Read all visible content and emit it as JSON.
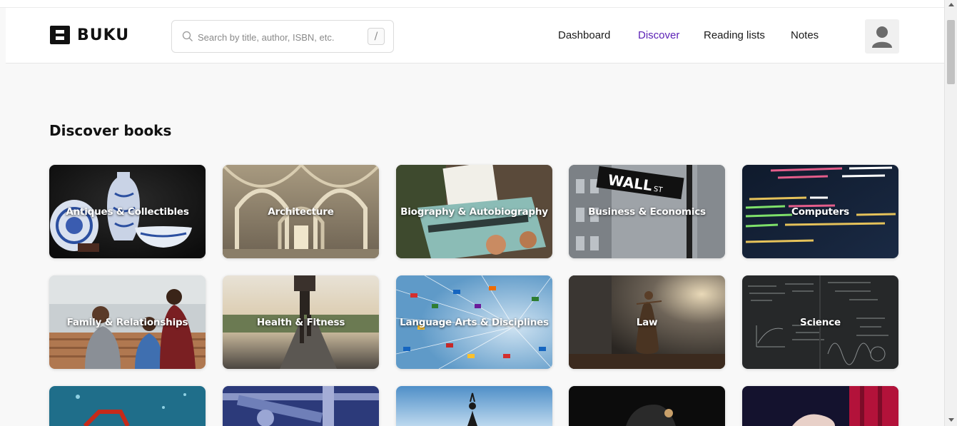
{
  "app": {
    "name": "BUKU"
  },
  "search": {
    "placeholder": "Search by title, author, ISBN, etc.",
    "shortcut": "/"
  },
  "nav": {
    "items": [
      {
        "label": "Dashboard",
        "active": false
      },
      {
        "label": "Discover",
        "active": true
      },
      {
        "label": "Reading lists",
        "active": false
      },
      {
        "label": "Notes",
        "active": false
      }
    ],
    "active_color": "#5b21b6"
  },
  "main": {
    "title": "Discover books",
    "categories": [
      {
        "label": "Antiques & Collectibles",
        "icon": "porcelain-vase"
      },
      {
        "label": "Architecture",
        "icon": "vaulted-hall"
      },
      {
        "label": "Biography & Autobiography",
        "icon": "typewriter"
      },
      {
        "label": "Business & Economics",
        "icon": "wall-street-sign"
      },
      {
        "label": "Computers",
        "icon": "code-screen"
      },
      {
        "label": "Family & Relationships",
        "icon": "family-kitchen"
      },
      {
        "label": "Health & Fitness",
        "icon": "runner-road"
      },
      {
        "label": "Language Arts & Disciplines",
        "icon": "world-flags"
      },
      {
        "label": "Law",
        "icon": "lady-justice"
      },
      {
        "label": "Science",
        "icon": "blackboard-equations"
      },
      {
        "label": "",
        "icon": "underwater-red"
      },
      {
        "label": "",
        "icon": "industrial-pipes"
      },
      {
        "label": "",
        "icon": "yoga-sky"
      },
      {
        "label": "",
        "icon": "dark-hands"
      },
      {
        "label": "",
        "icon": "red-curtain"
      }
    ]
  }
}
